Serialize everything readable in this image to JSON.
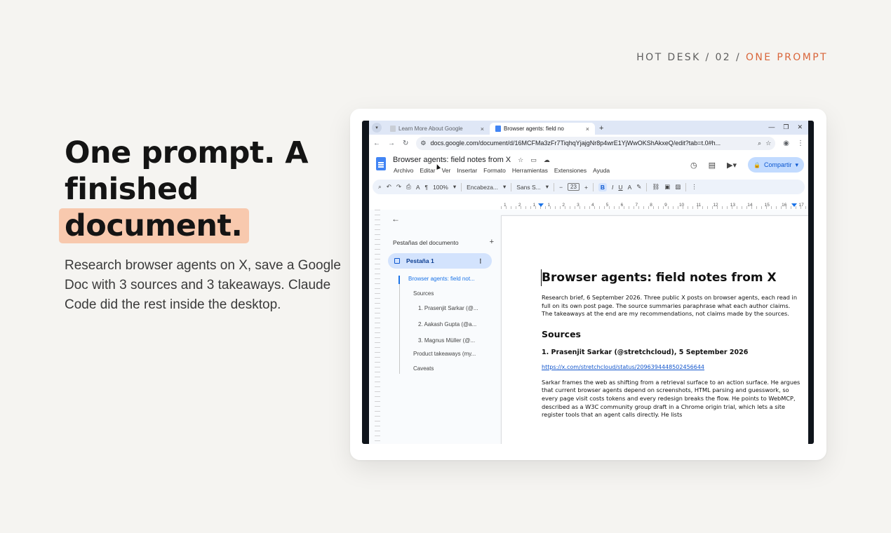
{
  "kicker": {
    "prefix": "HOT DESK / 02 /",
    "accent": "ONE PROMPT"
  },
  "headline": {
    "line1": "One prompt. A",
    "line2": "finished",
    "highlight": "document."
  },
  "subtext": "Research browser agents on X, save a Google Doc with 3 sources and 3 takeaways. Claude Code did the rest inside the desktop.",
  "colors": {
    "accent": "#d9653a",
    "highlight": "#f8c9ae",
    "background": "#f5f4f1"
  },
  "browser": {
    "tabs": [
      {
        "title": "Learn More About Google",
        "active": false
      },
      {
        "title": "Browser agents: field no",
        "active": true
      }
    ],
    "url": "docs.google.com/document/d/16MCFMa3zFr7TiqhqYjajgNr8p4wrE1YjWwOKShAkxeQ/edit?tab=t.0#h..."
  },
  "docs": {
    "title": "Browser agents: field notes from X",
    "menu": [
      "Archivo",
      "Editar",
      "Ver",
      "Insertar",
      "Formato",
      "Herramientas",
      "Extensiones",
      "Ayuda"
    ],
    "share_label": "Compartir",
    "toolbar": {
      "zoom": "100%",
      "style": "Encabeza...",
      "font": "Sans S...",
      "font_size": "23"
    },
    "ruler_numbers": [
      "1",
      "2",
      "1",
      "1",
      "2",
      "3",
      "4",
      "5",
      "6",
      "7",
      "8",
      "9",
      "10",
      "11",
      "12",
      "13",
      "14",
      "15",
      "16",
      "17"
    ],
    "outline": {
      "tabs_heading": "Pestañas del documento",
      "tab_label": "Pestaña 1",
      "items": [
        {
          "label": "Browser agents: field not...",
          "level": 1,
          "active": true
        },
        {
          "label": "Sources",
          "level": 2,
          "active": false
        },
        {
          "label": "1. Prasenjit Sarkar (@...",
          "level": 3,
          "active": false
        },
        {
          "label": "2. Aakash Gupta (@a...",
          "level": 3,
          "active": false
        },
        {
          "label": "3. Magnus Müller (@...",
          "level": 3,
          "active": false
        },
        {
          "label": "Product takeaways (my...",
          "level": 2,
          "active": false
        },
        {
          "label": "Caveats",
          "level": 2,
          "active": false
        }
      ]
    },
    "document": {
      "title": "Browser agents: field notes from X",
      "intro": "Research brief, 6 September 2026. Three public X posts on browser agents, each read in full on its own post page. The source summaries paraphrase what each author claims. The takeaways at the end are my recommendations, not claims made by the sources.",
      "sources_heading": "Sources",
      "source1_heading": "1. Prasenjit Sarkar (@stretchcloud), 5 September 2026",
      "source1_link": "https://x.com/stretchcloud/status/2096394448502456644",
      "source1_para": "Sarkar frames the web as shifting from a retrieval surface to an action surface. He argues that current browser agents depend on screenshots, HTML parsing and guesswork, so every page visit costs tokens and every redesign breaks the flow. He points to WebMCP, described as a W3C community group draft in a Chrome origin trial, which lets a site register tools that an agent calls directly. He lists"
    }
  }
}
